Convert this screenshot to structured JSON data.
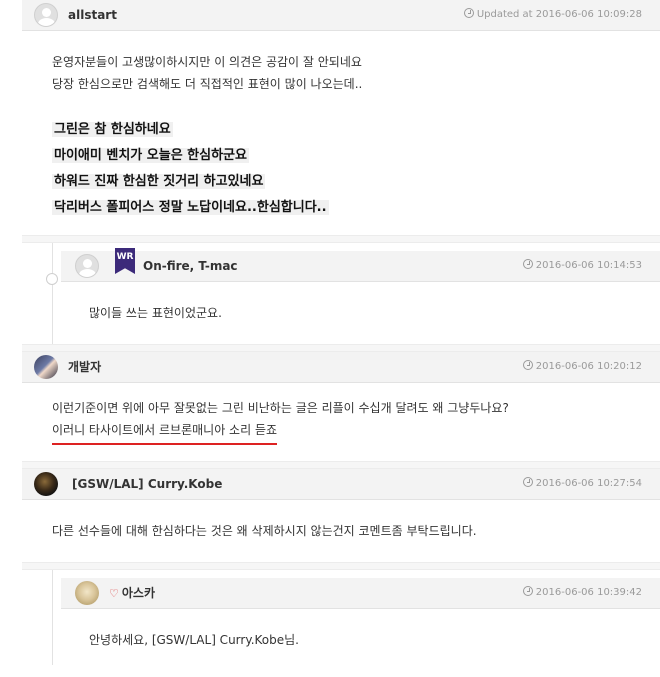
{
  "comments": [
    {
      "author": "allstart",
      "time": "Updated at 2016-06-06 10:09:28",
      "lines": [
        "운영자분들이 고생많이하시지만 이 의견은 공감이 잘 안되네요",
        "당장 한심으로만 검색해도 더 직접적인 표현이 많이 나오는데.."
      ],
      "bold_lines": [
        "그린은 참 한심하네요",
        "마이애미 벤치가 오늘은 한심하군요",
        "하워드 진짜 한심한 짓거리 하고있네요",
        "닥리버스 폴피어스 정말 노답이네요..한심합니다.."
      ]
    },
    {
      "author": "On-fire, T-mac",
      "badge": "WR",
      "time": "2016-06-06 10:14:53",
      "lines": [
        "많이들 쓰는 표현이었군요."
      ]
    },
    {
      "author": "개발자",
      "time": "2016-06-06 10:20:12",
      "lines": [
        "이런기준이면 위에 아무 잘못없는 그린 비난하는 글은 리플이 수십개 달려도 왜 그냥두나요?"
      ],
      "underlined": "이러니 타사이트에서 르브론매니아 소리 듣죠"
    },
    {
      "author": "[GSW/LAL] Curry.Kobe",
      "time": "2016-06-06 10:27:54",
      "lines": [
        "다른 선수들에 대해 한심하다는 것은 왜 삭제하시지 않는건지 코멘트좀 부탁드립니다."
      ]
    },
    {
      "author": "아스카",
      "time": "2016-06-06 10:39:42",
      "lines": [
        "안녕하세요, [GSW/LAL] Curry.Kobe님."
      ]
    }
  ]
}
